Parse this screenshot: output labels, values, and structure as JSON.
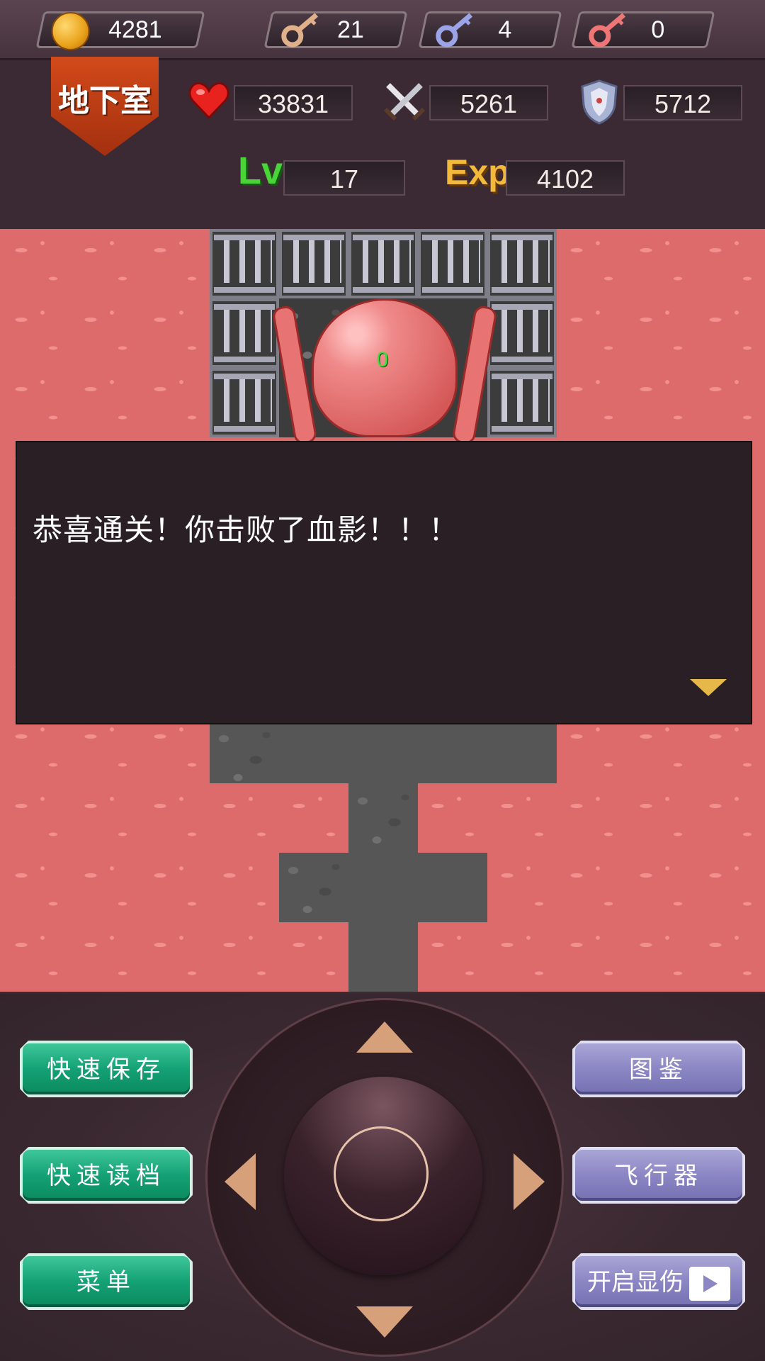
{
  "resources": {
    "gold": "4281",
    "yellow_keys": "21",
    "blue_keys": "4",
    "red_keys": "0"
  },
  "floor_name": "地下室",
  "stats": {
    "hp": "33831",
    "attack": "5261",
    "defense": "5712",
    "level_label": "Lv",
    "level": "17",
    "exp_label": "Exp",
    "exp": "4102"
  },
  "boss": {
    "damage_preview": "0"
  },
  "dialog": {
    "message": "恭喜通关！你击败了血影！！！"
  },
  "buttons": {
    "quick_save": "快速保存",
    "quick_load": "快速读档",
    "menu": "菜单",
    "monster_book": "图鉴",
    "fly": "飞行器",
    "show_damage": "开启显伤"
  },
  "colors": {
    "lava": "#de6b6b",
    "floor": "#565656",
    "green_button": "#14a174",
    "purple_button": "#8b86c4",
    "dialog_bg": "#2b1f26"
  },
  "icons": {
    "gold": "skull-coin-icon",
    "yellow_key": "key-icon",
    "blue_key": "key-icon",
    "red_key": "key-icon",
    "hp": "heart-icon",
    "attack": "crossed-swords-icon",
    "defense": "shield-icon",
    "show_damage": "video-icon"
  }
}
